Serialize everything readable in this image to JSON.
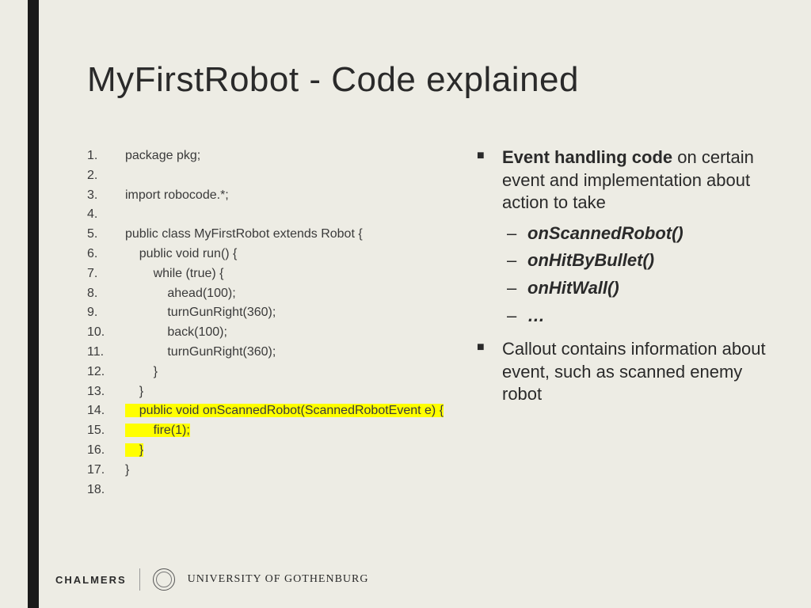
{
  "title": "MyFirstRobot - Code explained",
  "code": [
    {
      "n": "1.",
      "t": "package pkg;",
      "hl": false
    },
    {
      "n": "2.",
      "t": "",
      "hl": false
    },
    {
      "n": "3.",
      "t": "import robocode.*;",
      "hl": false
    },
    {
      "n": "4.",
      "t": "",
      "hl": false
    },
    {
      "n": "5.",
      "t": "public class MyFirstRobot extends Robot {",
      "hl": false
    },
    {
      "n": "6.",
      "t": "    public void run() {",
      "hl": false
    },
    {
      "n": "7.",
      "t": "        while (true) {",
      "hl": false
    },
    {
      "n": "8.",
      "t": "            ahead(100);",
      "hl": false
    },
    {
      "n": "9.",
      "t": "            turnGunRight(360);",
      "hl": false
    },
    {
      "n": "10.",
      "t": "            back(100);",
      "hl": false
    },
    {
      "n": "11.",
      "t": "            turnGunRight(360);",
      "hl": false
    },
    {
      "n": "12.",
      "t": "        }",
      "hl": false
    },
    {
      "n": "13.",
      "t": "    }",
      "hl": false
    },
    {
      "n": "14.",
      "t": "    public void onScannedRobot(ScannedRobotEvent e) {",
      "hl": true
    },
    {
      "n": "15.",
      "t": "        fire(1);",
      "hl": true
    },
    {
      "n": "16.",
      "t": "    }",
      "hl": true
    },
    {
      "n": "17.",
      "t": "}",
      "hl": false
    },
    {
      "n": "18.",
      "t": "",
      "hl": false
    }
  ],
  "bullets": {
    "b1_strong": "Event handling code",
    "b1_rest": " on certain event and implementation about action to take",
    "sub": [
      "onScannedRobot()",
      "onHitByBullet()",
      "onHitWall()",
      "…"
    ],
    "b2": "Callout contains information about event, such as scanned enemy robot"
  },
  "footer": {
    "chalmers": "CHALMERS",
    "uni": "UNIVERSITY OF GOTHENBURG"
  }
}
